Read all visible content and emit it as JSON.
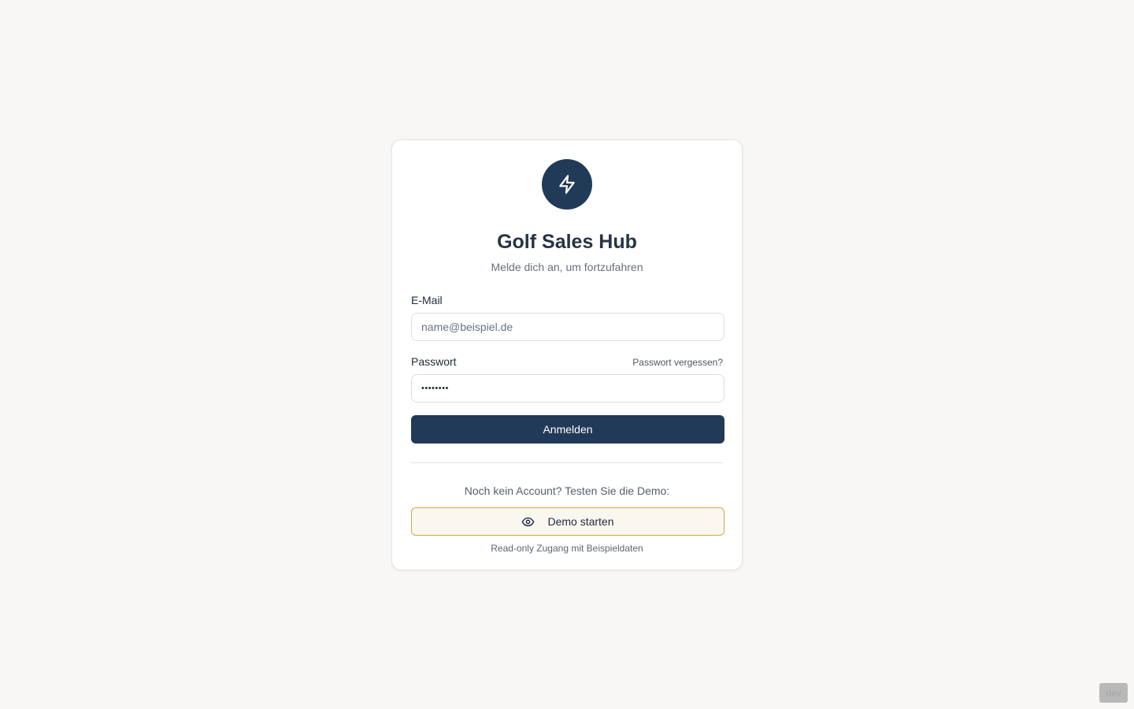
{
  "app": {
    "title": "Golf Sales Hub",
    "subtitle": "Melde dich an, um fortzufahren",
    "logo_icon": "lightning-bolt-icon"
  },
  "login_form": {
    "email_label": "E-Mail",
    "email_placeholder": "name@beispiel.de",
    "email_value": "",
    "password_label": "Passwort",
    "password_value": "••••••••",
    "forgot_password_link": "Passwort vergessen?",
    "submit_label": "Anmelden"
  },
  "demo": {
    "prompt": "Noch kein Account? Testen Sie die Demo:",
    "button_label": "Demo starten",
    "button_icon": "eye-icon",
    "note": "Read-only Zugang mit Beispieldaten"
  },
  "env_badge": "dev",
  "colors": {
    "primary": "#213a58",
    "accent_border": "#d4a93c",
    "background": "#f8f7f5"
  }
}
